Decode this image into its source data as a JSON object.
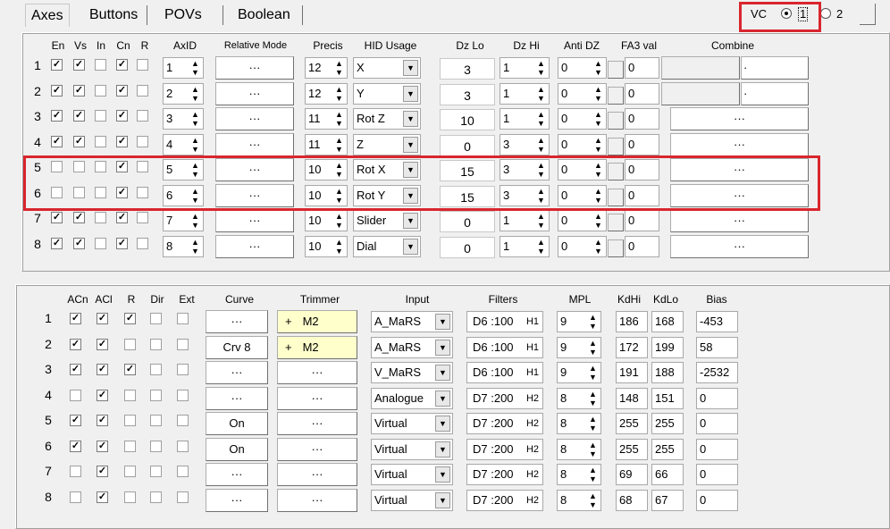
{
  "tabs": [
    "Axes",
    "Buttons",
    "POVs",
    "Boolean"
  ],
  "vc": {
    "label": "VC",
    "opt1": "1",
    "opt2": "2",
    "selected": "1"
  },
  "axes": {
    "headers": {
      "en": "En",
      "vs": "Vs",
      "in": "In",
      "cn": "Cn",
      "r": "R",
      "axid": "AxID",
      "relmode": "Relative Mode",
      "precis": "Precis",
      "hid": "HID Usage",
      "dzlo": "Dz Lo",
      "dzhi": "Dz Hi",
      "antidz": "Anti DZ",
      "fa3": "FA3 val",
      "combine": "Combine"
    },
    "rows": [
      {
        "n": "1",
        "en": true,
        "vs": true,
        "in": false,
        "cn": true,
        "r": false,
        "axid": "1",
        "rel": "···",
        "precis": "12",
        "hid": "X",
        "dzlo": "3",
        "dzhi": "1",
        "antidz": "0",
        "fa3": "0",
        "combine": "·"
      },
      {
        "n": "2",
        "en": true,
        "vs": true,
        "in": false,
        "cn": true,
        "r": false,
        "axid": "2",
        "rel": "···",
        "precis": "12",
        "hid": "Y",
        "dzlo": "3",
        "dzhi": "1",
        "antidz": "0",
        "fa3": "0",
        "combine": "·"
      },
      {
        "n": "3",
        "en": true,
        "vs": true,
        "in": false,
        "cn": true,
        "r": false,
        "axid": "3",
        "rel": "···",
        "precis": "11",
        "hid": "Rot Z",
        "dzlo": "10",
        "dzhi": "1",
        "antidz": "0",
        "fa3": "0",
        "combine": "···"
      },
      {
        "n": "4",
        "en": true,
        "vs": true,
        "in": false,
        "cn": true,
        "r": false,
        "axid": "4",
        "rel": "···",
        "precis": "11",
        "hid": "Z",
        "dzlo": "0",
        "dzhi": "3",
        "antidz": "0",
        "fa3": "0",
        "combine": "···"
      },
      {
        "n": "5",
        "en": false,
        "vs": false,
        "in": false,
        "cn": true,
        "r": false,
        "axid": "5",
        "rel": "···",
        "precis": "10",
        "hid": "Rot X",
        "dzlo": "15",
        "dzhi": "3",
        "antidz": "0",
        "fa3": "0",
        "combine": "···"
      },
      {
        "n": "6",
        "en": false,
        "vs": false,
        "in": false,
        "cn": true,
        "r": false,
        "axid": "6",
        "rel": "···",
        "precis": "10",
        "hid": "Rot Y",
        "dzlo": "15",
        "dzhi": "3",
        "antidz": "0",
        "fa3": "0",
        "combine": "···"
      },
      {
        "n": "7",
        "en": true,
        "vs": true,
        "in": false,
        "cn": true,
        "r": false,
        "axid": "7",
        "rel": "···",
        "precis": "10",
        "hid": "Slider",
        "dzlo": "0",
        "dzhi": "1",
        "antidz": "0",
        "fa3": "0",
        "combine": "···"
      },
      {
        "n": "8",
        "en": true,
        "vs": true,
        "in": false,
        "cn": true,
        "r": false,
        "axid": "8",
        "rel": "···",
        "precis": "10",
        "hid": "Dial",
        "dzlo": "0",
        "dzhi": "1",
        "antidz": "0",
        "fa3": "0",
        "combine": "···"
      }
    ]
  },
  "inputs": {
    "headers": {
      "acn": "ACn",
      "acl": "ACl",
      "r": "R",
      "dir": "Dir",
      "ext": "Ext",
      "curve": "Curve",
      "trimmer": "Trimmer",
      "input": "Input",
      "filters": "Filters",
      "mpl": "MPL",
      "kdhi": "KdHi",
      "kdlo": "KdLo",
      "bias": "Bias"
    },
    "rows": [
      {
        "n": "1",
        "acn": true,
        "acl": true,
        "r": true,
        "dir": false,
        "ext": false,
        "curve": "···",
        "trim": "M2",
        "trimPlus": "+",
        "input": "A_MaRS",
        "filter": "D6 :100",
        "ftag": "H1",
        "mpl": "9",
        "kdhi": "186",
        "kdlo": "168",
        "bias": "-453"
      },
      {
        "n": "2",
        "acn": true,
        "acl": true,
        "r": false,
        "dir": false,
        "ext": false,
        "curve": "Crv 8",
        "trim": "M2",
        "trimPlus": "+",
        "input": "A_MaRS",
        "filter": "D6 :100",
        "ftag": "H1",
        "mpl": "9",
        "kdhi": "172",
        "kdlo": "199",
        "bias": "58"
      },
      {
        "n": "3",
        "acn": true,
        "acl": true,
        "r": true,
        "dir": false,
        "ext": false,
        "curve": "···",
        "trim": "···",
        "trimPlus": "",
        "input": "V_MaRS",
        "filter": "D6 :100",
        "ftag": "H1",
        "mpl": "9",
        "kdhi": "191",
        "kdlo": "188",
        "bias": "-2532"
      },
      {
        "n": "4",
        "acn": false,
        "acl": true,
        "r": false,
        "dir": false,
        "ext": false,
        "curve": "···",
        "trim": "···",
        "trimPlus": "",
        "input": "Analogue",
        "filter": "D7 :200",
        "ftag": "H2",
        "mpl": "8",
        "kdhi": "148",
        "kdlo": "151",
        "bias": "0"
      },
      {
        "n": "5",
        "acn": true,
        "acl": true,
        "r": false,
        "dir": false,
        "ext": false,
        "curve": "On",
        "trim": "···",
        "trimPlus": "",
        "input": "Virtual",
        "filter": "D7 :200",
        "ftag": "H2",
        "mpl": "8",
        "kdhi": "255",
        "kdlo": "255",
        "bias": "0"
      },
      {
        "n": "6",
        "acn": true,
        "acl": true,
        "r": false,
        "dir": false,
        "ext": false,
        "curve": "On",
        "trim": "···",
        "trimPlus": "",
        "input": "Virtual",
        "filter": "D7 :200",
        "ftag": "H2",
        "mpl": "8",
        "kdhi": "255",
        "kdlo": "255",
        "bias": "0"
      },
      {
        "n": "7",
        "acn": false,
        "acl": true,
        "r": false,
        "dir": false,
        "ext": false,
        "curve": "···",
        "trim": "···",
        "trimPlus": "",
        "input": "Virtual",
        "filter": "D7 :200",
        "ftag": "H2",
        "mpl": "8",
        "kdhi": "69",
        "kdlo": "66",
        "bias": "0"
      },
      {
        "n": "8",
        "acn": false,
        "acl": true,
        "r": false,
        "dir": false,
        "ext": false,
        "curve": "···",
        "trim": "···",
        "trimPlus": "",
        "input": "Virtual",
        "filter": "D7 :200",
        "ftag": "H2",
        "mpl": "8",
        "kdhi": "68",
        "kdlo": "67",
        "bias": "0"
      }
    ]
  },
  "colors": {
    "highlight": "#d9262e",
    "trimmer": "#ffffcc"
  }
}
